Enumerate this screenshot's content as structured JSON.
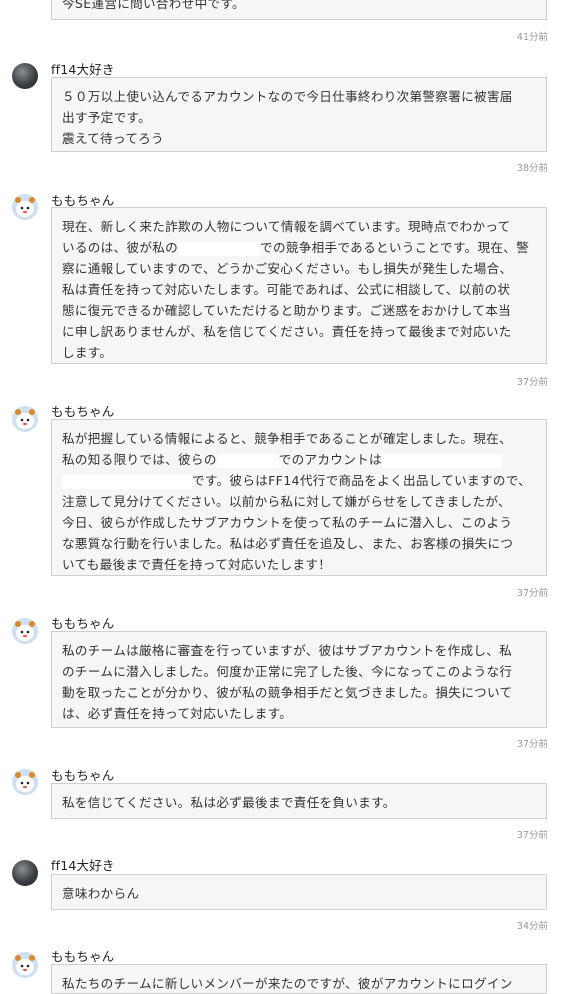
{
  "messages": [
    {
      "author": "",
      "avatar": "none",
      "lines": [
        "今SE運営に問い合わせ中です。"
      ],
      "time": "41分前"
    },
    {
      "author": "ff14大好き",
      "avatar": "user-avatar",
      "lines": [
        "５０万以上使い込んでるアカウントなので今日仕事終わり次第警察署に被害届",
        "出す予定です。",
        "震えて待ってろう"
      ],
      "time": "38分前"
    },
    {
      "author": "ももちゃん",
      "avatar": "momo-avatar",
      "lines": [
        "現在、新しく来た詐欺の人物について情報を調べています。現時点でわかって",
        "いるのは、彼が私の",
        "での競争相手であるということです。現在、警",
        "察に通報していますので、どうかご安心ください。もし損失が発生した場合、",
        "私は責任を持って対応いたします。可能であれば、公式に相談して、以前の状",
        "態に復元できるか確認していただけると助かります。ご迷惑をおかけして本当",
        "に申し訳ありませんが、私を信じてください。責任を持って最後まで対応いた",
        "します。"
      ],
      "time": "37分前"
    },
    {
      "author": "ももちゃん",
      "avatar": "momo-avatar",
      "lines": [
        "私が把握している情報によると、競争相手であることが確定しました。現在、",
        "私の知る限りでは、彼らの",
        "でのアカウントは",
        "です。彼らはFF14代行で商品をよく出品していますので、",
        "注意して見分けてください。以前から私に対して嫌がらせをしてきましたが、",
        "今日、彼らが作成したサブアカウントを使って私のチームに潜入し、このよう",
        "な悪質な行動を行いました。私は必ず責任を追及し、また、お客様の損失につ",
        "いても最後まで責任を持って対応いたします！"
      ],
      "time": "37分前"
    },
    {
      "author": "ももちゃん",
      "avatar": "momo-avatar",
      "lines": [
        "私のチームは厳格に審査を行っていますが、彼はサブアカウントを作成し、私",
        "のチームに潜入しました。何度か正常に完了した後、今になってこのような行",
        "動を取ったことが分かり、彼が私の競争相手だと気づきました。損失について",
        "は、必ず責任を持って対応いたします。"
      ],
      "time": "37分前"
    },
    {
      "author": "ももちゃん",
      "avatar": "momo-avatar",
      "lines": [
        "私を信じてください。私は必ず最後まで責任を負います。"
      ],
      "time": "37分前"
    },
    {
      "author": "ff14大好き",
      "avatar": "user-avatar",
      "lines": [
        "意味わからん"
      ],
      "time": "34分前"
    },
    {
      "author": "ももちゃん",
      "avatar": "momo-avatar",
      "lines": [
        "私たちのチームに新しいメンバーが来たのですが、彼がアカウントにログイン"
      ],
      "time": ""
    }
  ]
}
